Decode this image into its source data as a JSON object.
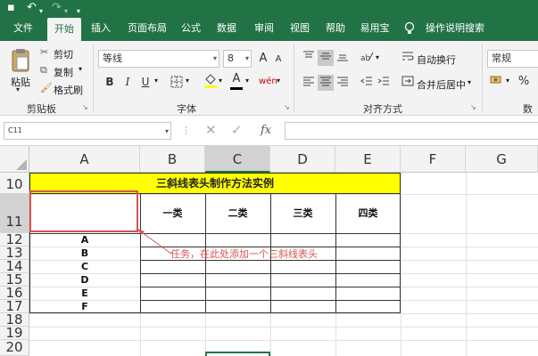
{
  "quick_access": {
    "undo": "↶",
    "redo": "↷"
  },
  "tabs": [
    "文件",
    "开始",
    "插入",
    "页面布局",
    "公式",
    "数据",
    "审阅",
    "视图",
    "帮助",
    "易用宝",
    "操作说明搜索"
  ],
  "ribbon": {
    "clipboard": {
      "paste": "粘贴",
      "cut": "剪切",
      "copy": "复制",
      "format_painter": "格式刷",
      "group": "剪贴板"
    },
    "font": {
      "name": "等线",
      "size": "8",
      "bold": "B",
      "italic": "I",
      "underline": "U",
      "grow": "A",
      "shrink": "A",
      "wen": "wén",
      "group": "字体"
    },
    "alignment": {
      "wrap": "自动换行",
      "merge": "合并后居中",
      "group": "对齐方式"
    },
    "number": {
      "format": "常规",
      "percent": "%",
      "group": "数"
    }
  },
  "formula_bar": {
    "name_box": "C11",
    "fx": "fx",
    "content": ""
  },
  "grid": {
    "columns": [
      "A",
      "B",
      "C",
      "D",
      "E",
      "F",
      "G"
    ],
    "rows": [
      "10",
      "11",
      "12",
      "13",
      "14",
      "15",
      "16",
      "17",
      "18",
      "19",
      "20"
    ],
    "title": "三斜线表头制作方法实例",
    "headers": [
      "一类",
      "二类",
      "三类",
      "四类"
    ],
    "row_labels": [
      "A",
      "B",
      "C",
      "D",
      "E",
      "F"
    ],
    "annotation": "任务，在此处添加一个三斜线表头"
  },
  "colors": {
    "brand": "#217346",
    "title_fill": "#ffff00",
    "annotation": "#d9534f"
  }
}
